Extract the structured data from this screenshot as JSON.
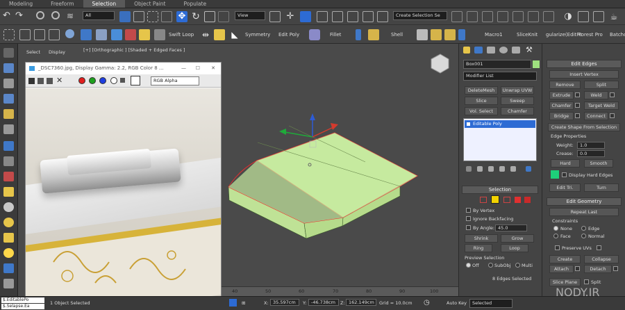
{
  "ribbon": {
    "tabs": [
      "Modeling",
      "Freeform",
      "Selection",
      "Object Paint",
      "Populate"
    ]
  },
  "toolbar1": {
    "filter_value": "All",
    "refcoord_value": "View",
    "named_selection_placeholder": "Create Selection Se"
  },
  "toolbar2": {
    "swift_loop": "Swift Loop",
    "symmetry": "Symmetry",
    "edit_poly": "Edit Poly",
    "fillet": "Fillet",
    "shell": "Shell",
    "macro1": "Macro1",
    "slice_knit": "SliceKnit",
    "regularize": "gularize(EditPc",
    "forest_pro": "Forest Pro",
    "batch": "Batcho"
  },
  "scene_explorer": {
    "select": "Select",
    "display": "Display"
  },
  "viewport": {
    "label": "[+] [Orthographic ] [Shaded + Edged Faces ]"
  },
  "frame_buffer": {
    "title": "_DSC7360.jpg, Display Gamma: 2.2, RGB Color 8 ...",
    "channel_value": "RGB Alpha"
  },
  "command_panel": {
    "object_name": "Box001",
    "modifier_list": "Modifier List",
    "buttons": [
      "DeleteMesh",
      "Unwrap UVW",
      "Slice",
      "Sweep",
      "Vol. Select",
      "Chamfer"
    ],
    "stack_item": "Editable Poly",
    "selection": {
      "header": "Selection",
      "by_vertex": "By Vertex",
      "ignore_backfacing": "Ignore Backfacing",
      "by_angle": "By Angle:",
      "angle_value": "45.0",
      "shrink": "Shrink",
      "grow": "Grow",
      "ring": "Ring",
      "loop": "Loop",
      "preview_selection": "Preview Selection",
      "off": "Off",
      "subobj": "SubObj",
      "multi": "Multi",
      "status": "8 Edges Selected"
    }
  },
  "edit_edges": {
    "header": "Edit Edges",
    "insert_vertex": "Insert Vertex",
    "remove": "Remove",
    "split": "Split",
    "extrude": "Extrude",
    "weld": "Weld",
    "chamfer": "Chamfer",
    "target_weld": "Target Weld",
    "bridge": "Bridge",
    "connect": "Connect",
    "create_shape": "Create Shape From Selection",
    "edge_properties": "Edge Properties",
    "weight_label": "Weight:",
    "weight_value": "1.0",
    "crease_label": "Crease:",
    "crease_value": "0.0",
    "hard": "Hard",
    "smooth": "Smooth",
    "display_hard_edges": "Display Hard Edges",
    "edit_tri": "Edit Tri.",
    "turn": "Turn"
  },
  "edit_geometry": {
    "header": "Edit Geometry",
    "repeat_last": "Repeat Last",
    "constraints": "Constraints",
    "none": "None",
    "edge": "Edge",
    "face": "Face",
    "normal": "Normal",
    "preserve_uvs": "Preserve UVs",
    "create": "Create",
    "collapse": "Collapse",
    "attach": "Attach",
    "detach": "Detach",
    "slice_plane": "Slice Plane",
    "split": "Split"
  },
  "timeline": {
    "ticks": [
      "40",
      "50",
      "60",
      "70",
      "80",
      "90",
      "100"
    ]
  },
  "status": {
    "script_text": "$.EditablePo",
    "script_text2": "$.Selapse.Ea",
    "objects_selected": "1 Object Selected",
    "x_label": "X:",
    "x_value": "35.597cm",
    "y_label": "Y:",
    "y_value": "-46.738cm",
    "z_label": "Z:",
    "z_value": "162.149cm",
    "grid": "Grid = 10.0cm",
    "auto_key": "Auto Key",
    "selected": "Selected"
  },
  "watermark": "NODY.IR",
  "colors": {
    "box_face": "#c6ea9f",
    "selection_red": "#e03030",
    "accent_blue": "#2d6bd4"
  }
}
